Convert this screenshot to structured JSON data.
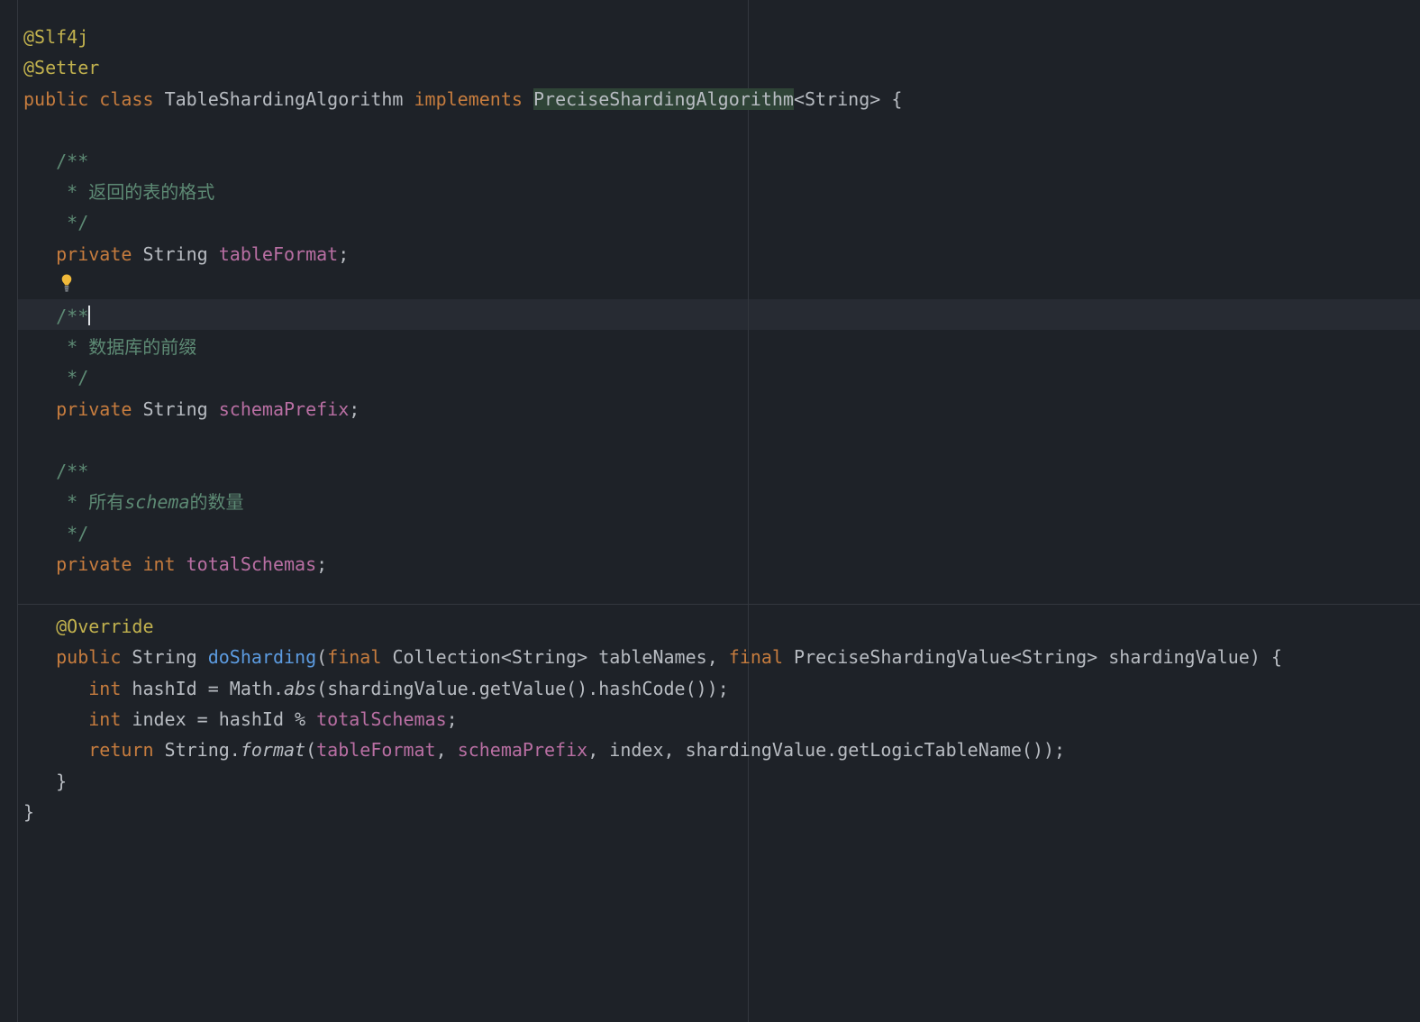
{
  "annotations": {
    "slf4j": "@Slf4j",
    "setter": "@Setter",
    "override": "@Override"
  },
  "keywords": {
    "public": "public",
    "class": "class",
    "implements": "implements",
    "private": "private",
    "final": "final",
    "return": "return",
    "int": "int"
  },
  "types": {
    "String": "String",
    "Collection": "Collection",
    "PreciseShardingAlgorithm": "PreciseShardingAlgorithm",
    "PreciseShardingValue": "PreciseShardingValue",
    "Math": "Math"
  },
  "class_name": "TableShardingAlgorithm",
  "fields": {
    "tableFormat": "tableFormat",
    "schemaPrefix": "schemaPrefix",
    "totalSchemas": "totalSchemas"
  },
  "method": {
    "name": "doSharding",
    "param_tableNames": "tableNames",
    "param_shardingValue": "shardingValue"
  },
  "locals": {
    "hashId": "hashId",
    "index": "index"
  },
  "calls": {
    "abs": "abs",
    "getValue": "getValue",
    "hashCode": "hashCode",
    "format": "format",
    "getLogicTableName": "getLogicTableName"
  },
  "comments": {
    "doc_open": "/**",
    "doc_close": " */",
    "doc_open_caret": "/**",
    "tableFormat_body": " * 返回的表的格式",
    "schemaPrefix_body": " * 数据库的前缀",
    "totalSchemas_prefix": " * 所有",
    "totalSchemas_italic": "schema",
    "totalSchemas_suffix": "的数量"
  },
  "punc": {
    "lt": "<",
    "gt": ">",
    "lbrace": "{",
    "rbrace": "}",
    "lparen": "(",
    "rparen": ")",
    "comma": ",",
    "semi": ";",
    "eq": " = ",
    "dot": ".",
    "mod": " % "
  }
}
